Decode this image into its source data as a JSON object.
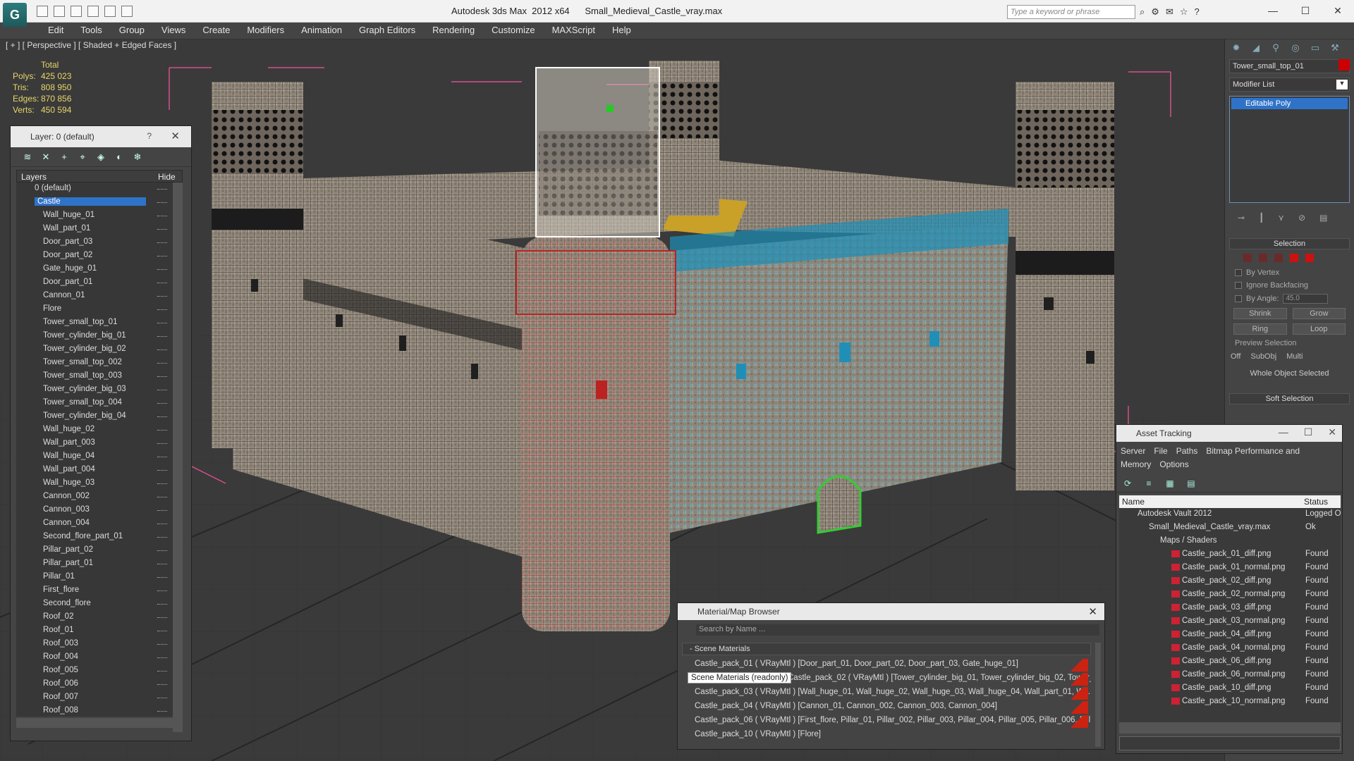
{
  "app": {
    "title": "Autodesk 3ds Max  2012 x64",
    "file": "Small_Medieval_Castle_vray.max",
    "search_placeholder": "Type a keyword or phrase",
    "logo": "max-logo"
  },
  "menu": [
    "Edit",
    "Tools",
    "Group",
    "Views",
    "Create",
    "Modifiers",
    "Animation",
    "Graph Editors",
    "Rendering",
    "Customize",
    "MAXScript",
    "Help"
  ],
  "viewport": {
    "label": "[ + ] [ Perspective ] [ Shaded + Edged Faces ]",
    "stats": {
      "header": "Total",
      "rows": [
        {
          "k": "Polys:",
          "v": "425 023"
        },
        {
          "k": "Tris:",
          "v": "808 950"
        },
        {
          "k": "Edges:",
          "v": "870 856"
        },
        {
          "k": "Verts:",
          "v": "450 594"
        }
      ]
    }
  },
  "layer_window": {
    "title": "Layer: 0 (default)",
    "help": "?",
    "close": "✕",
    "col_layers": "Layers",
    "col_hide": "Hide",
    "rows": [
      {
        "name": "0 (default)",
        "level": 0
      },
      {
        "name": "Castle",
        "level": 0,
        "selected": true
      },
      {
        "name": "Wall_huge_01",
        "level": 1
      },
      {
        "name": "Wall_part_01",
        "level": 1
      },
      {
        "name": "Door_part_03",
        "level": 1
      },
      {
        "name": "Door_part_02",
        "level": 1
      },
      {
        "name": "Gate_huge_01",
        "level": 1
      },
      {
        "name": "Door_part_01",
        "level": 1
      },
      {
        "name": "Cannon_01",
        "level": 1
      },
      {
        "name": "Flore",
        "level": 1
      },
      {
        "name": "Tower_small_top_01",
        "level": 1
      },
      {
        "name": "Tower_cylinder_big_01",
        "level": 1
      },
      {
        "name": "Tower_cylinder_big_02",
        "level": 1
      },
      {
        "name": "Tower_small_top_002",
        "level": 1
      },
      {
        "name": "Tower_small_top_003",
        "level": 1
      },
      {
        "name": "Tower_cylinder_big_03",
        "level": 1
      },
      {
        "name": "Tower_small_top_004",
        "level": 1
      },
      {
        "name": "Tower_cylinder_big_04",
        "level": 1
      },
      {
        "name": "Wall_huge_02",
        "level": 1
      },
      {
        "name": "Wall_part_003",
        "level": 1
      },
      {
        "name": "Wall_huge_04",
        "level": 1
      },
      {
        "name": "Wall_part_004",
        "level": 1
      },
      {
        "name": "Wall_huge_03",
        "level": 1
      },
      {
        "name": "Cannon_002",
        "level": 1
      },
      {
        "name": "Cannon_003",
        "level": 1
      },
      {
        "name": "Cannon_004",
        "level": 1
      },
      {
        "name": "Second_flore_part_01",
        "level": 1
      },
      {
        "name": "Pillar_part_02",
        "level": 1
      },
      {
        "name": "Pillar_part_01",
        "level": 1
      },
      {
        "name": "Pillar_01",
        "level": 1
      },
      {
        "name": "First_flore",
        "level": 1
      },
      {
        "name": "Second_flore",
        "level": 1
      },
      {
        "name": "Roof_02",
        "level": 1
      },
      {
        "name": "Roof_01",
        "level": 1
      },
      {
        "name": "Roof_003",
        "level": 1
      },
      {
        "name": "Roof_004",
        "level": 1
      },
      {
        "name": "Roof_005",
        "level": 1
      },
      {
        "name": "Roof_006",
        "level": 1
      },
      {
        "name": "Roof_007",
        "level": 1
      },
      {
        "name": "Roof_008",
        "level": 1
      }
    ]
  },
  "command_panel": {
    "object_name": "Tower_small_top_01",
    "object_color": "#cc0000",
    "modifier_list": "Modifier List",
    "stack_item": "Editable Poly",
    "selection_title": "Selection",
    "by_vertex": "By Vertex",
    "ignore_backfacing": "Ignore Backfacing",
    "by_angle": "By Angle:",
    "angle_value": "45.0",
    "shrink": "Shrink",
    "grow": "Grow",
    "ring": "Ring",
    "loop": "Loop",
    "preview_selection": "Preview Selection",
    "off": "Off",
    "subobj": "SubObj",
    "multi": "Multi",
    "whole_object": "Whole Object Selected",
    "soft_selection": "Soft Selection"
  },
  "material_browser": {
    "title": "Material/Map Browser",
    "search": "Search by Name ...",
    "section": "- Scene Materials",
    "tooltip": "Scene Materials (readonly)",
    "rows": [
      "Castle_pack_01  ( VRayMtl )  [Door_part_01, Door_part_02, Door_part_03, Gate_huge_01]",
      "Castle_pack_02  ( VRayMtl )  [Tower_cylinder_big_01, Tower_cylinder_big_02, Tower_cylinder_big_03, Towe...",
      "Castle_pack_03  ( VRayMtl )  [Wall_huge_01, Wall_huge_02, Wall_huge_03, Wall_huge_04, Wall_part_01, W...",
      "Castle_pack_04  ( VRayMtl )  [Cannon_01, Cannon_002, Cannon_003, Cannon_004]",
      "Castle_pack_06  ( VRayMtl )  [First_flore, Pillar_01, Pillar_002, Pillar_003, Pillar_004, Pillar_005, Pillar_006, Pill...",
      "Castle_pack_10  ( VRayMtl )  [Flore]"
    ]
  },
  "asset_tracking": {
    "title": "Asset Tracking",
    "menu": [
      "Server",
      "File",
      "Paths",
      "Bitmap Performance and Memory",
      "Options"
    ],
    "col_name": "Name",
    "col_status": "Status",
    "rows": [
      {
        "name": "Autodesk Vault 2012",
        "status": "Logged O",
        "indent": 1
      },
      {
        "name": "Small_Medieval_Castle_vray.max",
        "status": "Ok",
        "indent": 2
      },
      {
        "name": "Maps / Shaders",
        "status": "",
        "indent": 3
      },
      {
        "name": "Castle_pack_01_diff.png",
        "status": "Found",
        "indent": 4
      },
      {
        "name": "Castle_pack_01_normal.png",
        "status": "Found",
        "indent": 4
      },
      {
        "name": "Castle_pack_02_diff.png",
        "status": "Found",
        "indent": 4
      },
      {
        "name": "Castle_pack_02_normal.png",
        "status": "Found",
        "indent": 4
      },
      {
        "name": "Castle_pack_03_diff.png",
        "status": "Found",
        "indent": 4
      },
      {
        "name": "Castle_pack_03_normal.png",
        "status": "Found",
        "indent": 4
      },
      {
        "name": "Castle_pack_04_diff.png",
        "status": "Found",
        "indent": 4
      },
      {
        "name": "Castle_pack_04_normal.png",
        "status": "Found",
        "indent": 4
      },
      {
        "name": "Castle_pack_06_diff.png",
        "status": "Found",
        "indent": 4
      },
      {
        "name": "Castle_pack_06_normal.png",
        "status": "Found",
        "indent": 4
      },
      {
        "name": "Castle_pack_10_diff.png",
        "status": "Found",
        "indent": 4
      },
      {
        "name": "Castle_pack_10_normal.png",
        "status": "Found",
        "indent": 4
      }
    ]
  }
}
